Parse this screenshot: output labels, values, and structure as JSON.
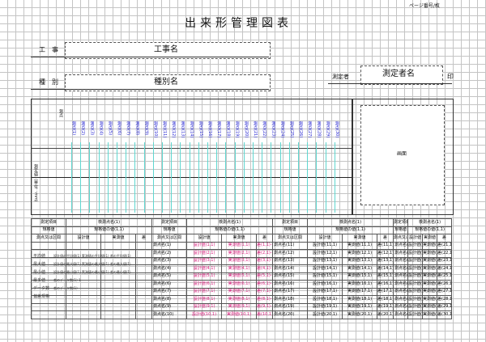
{
  "header": {
    "title": "出来形管理図表",
    "page_label": "ページ番号/枚",
    "construction_label": "工　事",
    "construction_value": "工事名",
    "type_label": "種　別",
    "type_value": "種別名",
    "measurer_label": "測定者",
    "measurer_value": "測定者名",
    "seal_label": "印"
  },
  "chart": {
    "y_label": "測定値（単位：mm）",
    "x_label": "測点",
    "dates": [
      "測点(1)",
      "測点(2)",
      "測点(3)",
      "測点(4)",
      "測点(5)",
      "測点(6)",
      "測点(7)",
      "測点(8)",
      "測点(9)",
      "測点(10)",
      "測点(11)",
      "測点(12)",
      "測点(13)",
      "測点(14)",
      "測点(15)",
      "測点(16)",
      "測点(17)",
      "測点(18)",
      "測点(19)",
      "測点(20)",
      "測点(21)",
      "測点(22)",
      "測点(23)",
      "測点(24)",
      "測点(25)",
      "測点(26)",
      "測点(27)",
      "測点(28)",
      "測点(29)",
      "測点(30)"
    ],
    "image_label": "画面"
  },
  "table": {
    "h_station": "測定項目",
    "h_design": "規格値",
    "h_place": "測点又は区間",
    "h_design_val": "設計値",
    "h_actual": "実測値",
    "h_diff": "差",
    "groups": [
      {
        "item": "検測点名(1)",
        "spec": "規格値の値(1,1)"
      },
      {
        "item": "検測点名(1)",
        "spec": "規格値の値(1,1)"
      },
      {
        "item": "検測点名(1)",
        "spec": "規格値の値(1,1)"
      },
      {
        "item": "検測点名(1)",
        "spec": "規格値の値(1,1)"
      }
    ],
    "stats": [
      {
        "label": "平均値",
        "text": "設計値の平均値(1)  実測値の平均値(1)  差の平均値(1)"
      },
      {
        "label": "最大値",
        "text": "設計値の最大値(1)  実測値の最大値(1)  差の最大値(1)"
      },
      {
        "label": "最小値",
        "text": "設計値の最小値(1)  実測値の最小値(1)  差の最小値(1)"
      },
      {
        "label": "最多値",
        "text": "差のデータ数(1)-1"
      },
      {
        "label": "データ数",
        "text": "差のデータ数(1)"
      },
      {
        "label": "偏差規格",
        "text": ""
      }
    ],
    "rows": [
      [
        "測点名(1)",
        "設計値(1,1)",
        "実測値(1,1)",
        "差(1,1)-1",
        "測点名(11)",
        "設計値(11,1)",
        "実測値(11,1)",
        "差(11,1)-1",
        "測点名(21)",
        "設計値(21,1)",
        "実測値(21,1)",
        "差(21,1)-1"
      ],
      [
        "測点名(2)",
        "設計値(2,1)",
        "実測値(2,1)",
        "差(2,1)-1",
        "測点名(12)",
        "設計値(12,1)",
        "実測値(12,1)",
        "差(12,1)-1",
        "測点名(22)",
        "設計値(22,1)",
        "実測値(22,1)",
        "差(22,1)-1"
      ],
      [
        "測点名(3)",
        "設計値(3,1)",
        "実測値(3,1)",
        "差(3,1)-1",
        "測点名(13)",
        "設計値(13,1)",
        "実測値(13,1)",
        "差(13,1)-1",
        "測点名(23)",
        "設計値(23,1)",
        "実測値(23,1)",
        "差(23,1)-1"
      ],
      [
        "測点名(4)",
        "設計値(4,1)",
        "実測値(4,1)",
        "差(4,1)-1",
        "測点名(14)",
        "設計値(14,1)",
        "実測値(14,1)",
        "差(14,1)-1",
        "測点名(24)",
        "設計値(24,1)",
        "実測値(24,1)",
        "差(24,1)-1"
      ],
      [
        "測点名(5)",
        "設計値(5,1)",
        "実測値(5,1)",
        "差(5,1)-1",
        "測点名(15)",
        "設計値(15,1)",
        "実測値(15,1)",
        "差(15,1)-1",
        "測点名(25)",
        "設計値(25,1)",
        "実測値(25,1)",
        "差(25,1)-1"
      ],
      [
        "測点名(6)",
        "設計値(6,1)",
        "実測値(6,1)",
        "差(6,1)-1",
        "測点名(16)",
        "設計値(16,1)",
        "実測値(16,1)",
        "差(16,1)-1",
        "測点名(26)",
        "設計値(26,1)",
        "実測値(26,1)",
        "差(26,1)-1"
      ],
      [
        "測点名(7)",
        "設計値(7,1)",
        "実測値(7,1)",
        "差(7,1)-1",
        "測点名(17)",
        "設計値(17,1)",
        "実測値(17,1)",
        "差(17,1)-1",
        "測点名(27)",
        "設計値(27,1)",
        "実測値(27,1)",
        "差(27,1)-1"
      ],
      [
        "測点名(8)",
        "設計値(8,1)",
        "実測値(8,1)",
        "差(8,1)-1",
        "測点名(18)",
        "設計値(18,1)",
        "実測値(18,1)",
        "差(18,1)-1",
        "測点名(28)",
        "設計値(28,1)",
        "実測値(28,1)",
        "差(28,1)-1"
      ],
      [
        "測点名(9)",
        "設計値(9,1)",
        "実測値(9,1)",
        "差(9,1)-1",
        "測点名(19)",
        "設計値(19,1)",
        "実測値(19,1)",
        "差(19,1)-1",
        "測点名(29)",
        "設計値(29,1)",
        "実測値(29,1)",
        "差(29,1)-1"
      ],
      [
        "測点名(10)",
        "設計値(10,1)",
        "実測値(10,1)",
        "差(10,1)-1",
        "測点名(20)",
        "設計値(20,1)",
        "実測値(20,1)",
        "差(20,1)-1",
        "測点名(30)",
        "設計値(30,1)",
        "実測値(30,1)",
        "差(30,1)-1"
      ]
    ]
  },
  "colors": {
    "accent_blue": "#1717d0",
    "accent_pink": "#d8197a",
    "measure_line": "#5fd7d0"
  }
}
